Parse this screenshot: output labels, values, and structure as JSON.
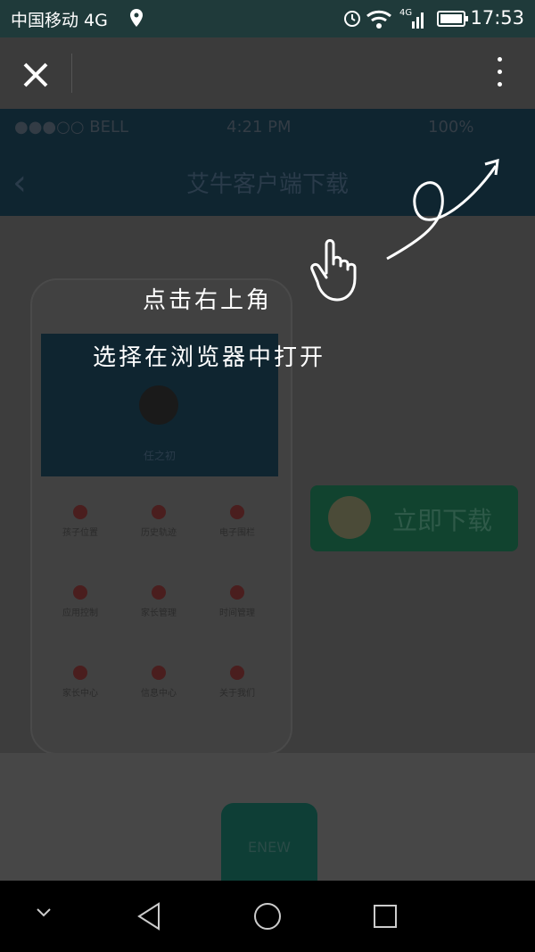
{
  "status_bar": {
    "carrier": "中国移动 4G",
    "network": "4G",
    "time": "17:53"
  },
  "top_bar": {
    "close_icon": "close-icon",
    "more_icon": "more-vertical-icon"
  },
  "page": {
    "inner_status": {
      "carrier": "●●●○○ BELL",
      "time": "4:21 PM",
      "battery": "100%"
    },
    "title": "艾牛客户端下载",
    "phone": {
      "profile_name": "任之初",
      "grid": [
        [
          "孩子位置",
          "历史轨迹",
          "电子围栏"
        ],
        [
          "应用控制",
          "家长管理",
          "时间管理"
        ],
        [
          "家长中心",
          "信息中心",
          "关于我们"
        ]
      ]
    },
    "download_button": "立即下载",
    "logo_text": "ENEW"
  },
  "overlay": {
    "line1": "点击右上角",
    "line2": "选择在浏览器中打开",
    "hand_icon": "pointing-hand-icon",
    "arrow_icon": "curved-arrow-icon"
  },
  "nav_bar": {
    "icons": [
      "chevron-down-icon",
      "back-triangle-icon",
      "home-circle-icon",
      "recents-square-icon"
    ]
  }
}
